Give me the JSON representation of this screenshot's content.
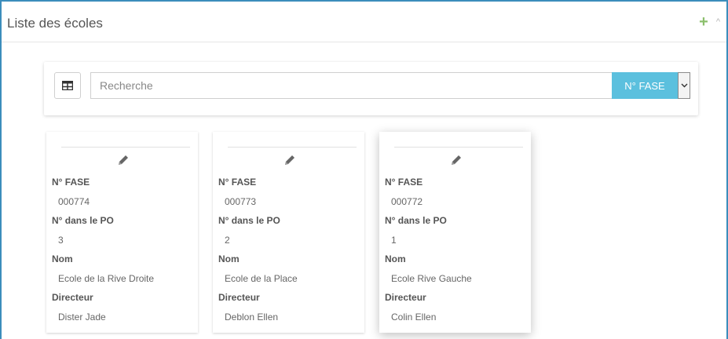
{
  "panel": {
    "title": "Liste des écoles",
    "add_icon": "plus-icon",
    "collapse_icon": "chevron-up-icon"
  },
  "search": {
    "placeholder": "Recherche",
    "value": "",
    "field_button_label": "N° FASE",
    "dropdown_icon": "chevron-down-icon",
    "view_toggle_icon": "table-icon"
  },
  "field_labels": {
    "fase": "N° FASE",
    "po": "N° dans le PO",
    "nom": "Nom",
    "directeur": "Directeur"
  },
  "schools": [
    {
      "fase": "000774",
      "po": "3",
      "nom": "Ecole de la Rive Droite",
      "directeur": "Dister Jade"
    },
    {
      "fase": "000773",
      "po": "2",
      "nom": "Ecole de la Place",
      "directeur": "Deblon Ellen"
    },
    {
      "fase": "000772",
      "po": "1",
      "nom": "Ecole Rive Gauche",
      "directeur": "Colin Ellen"
    }
  ],
  "colors": {
    "accent_border": "#3c8dbc",
    "button_info": "#5bc0de",
    "add_green": "#8bbf6c"
  }
}
